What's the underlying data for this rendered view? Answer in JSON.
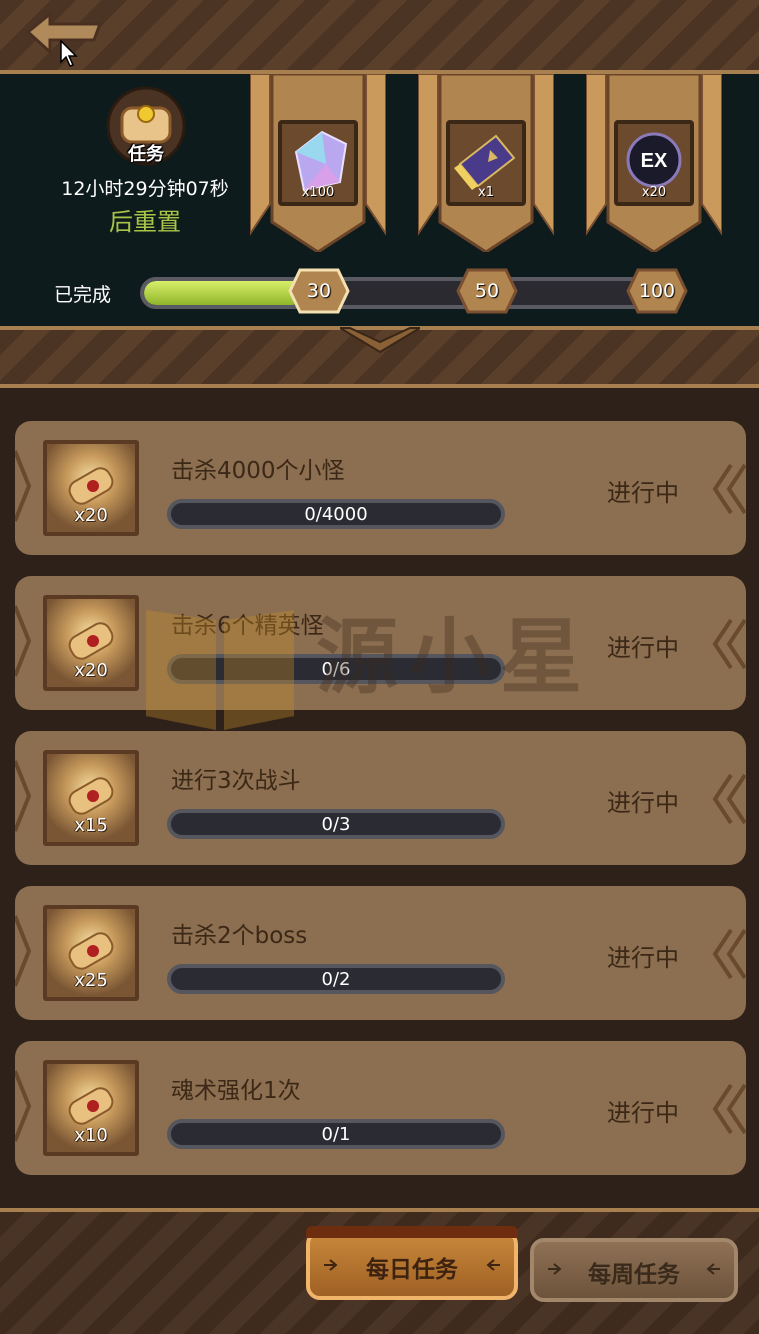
{
  "header": {
    "mission_label": "任务",
    "timer": "12小时29分钟07秒",
    "reset_text": "后重置",
    "rewards": [
      {
        "icon": "crystal-icon",
        "count": "x100"
      },
      {
        "icon": "ticket-icon",
        "count": "x1"
      },
      {
        "icon": "ex-badge-icon",
        "count": "x20",
        "badge_text": "EX"
      }
    ],
    "progress": {
      "label": "已完成",
      "fraction": 0.3,
      "milestones": [
        "30",
        "50",
        "100"
      ]
    }
  },
  "tasks": [
    {
      "title": "击杀4000个小怪",
      "progress": "0/4000",
      "reward_qty": "x20",
      "status": "进行中"
    },
    {
      "title": "击杀6个精英怪",
      "progress": "0/6",
      "reward_qty": "x20",
      "status": "进行中"
    },
    {
      "title": "进行3次战斗",
      "progress": "0/3",
      "reward_qty": "x15",
      "status": "进行中"
    },
    {
      "title": "击杀2个boss",
      "progress": "0/2",
      "reward_qty": "x25",
      "status": "进行中"
    },
    {
      "title": "魂术强化1次",
      "progress": "0/1",
      "reward_qty": "x10",
      "status": "进行中"
    }
  ],
  "watermark": {
    "text": "源小星"
  },
  "tabs": {
    "daily": "每日任务",
    "weekly": "每周任务"
  },
  "colors": {
    "accent_green": "#a9c548",
    "card_bg": "#8c6e50",
    "wood_border": "#a8804f",
    "header_bg": "#0e1b1c"
  }
}
